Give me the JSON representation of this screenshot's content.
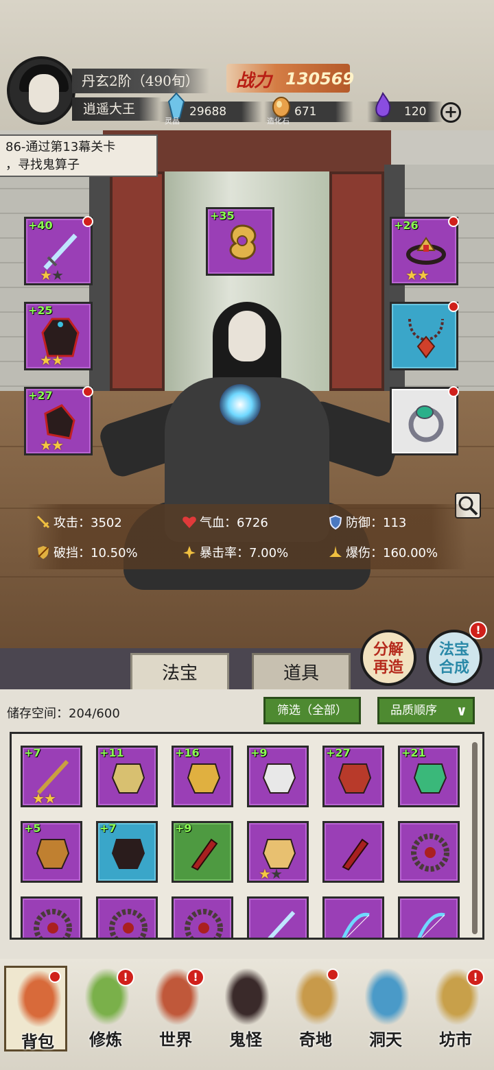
{
  "player": {
    "rank": "丹玄2阶（490旬）",
    "name": "逍遥大王",
    "power_label": "战力",
    "power_value": "130569"
  },
  "resources": [
    {
      "name": "灵晶",
      "value": "29688",
      "icon": "spirit-crystal-icon",
      "color": "#6fc3e8"
    },
    {
      "name": "造化石",
      "value": "671",
      "icon": "creation-stone-icon",
      "color": "#e8a14a"
    },
    {
      "name": "",
      "value": "120",
      "icon": "purple-flame-icon",
      "color": "#8a4de0"
    }
  ],
  "quest": {
    "text_line1": "86-通过第13幕关卡",
    "text_line2": "，寻找鬼算子"
  },
  "equipment": {
    "left": [
      {
        "level": "+40",
        "stars": 1,
        "max_stars": 2,
        "rarity": "purple",
        "item": "sword",
        "dot": true
      },
      {
        "level": "+25",
        "stars": 2,
        "max_stars": 2,
        "rarity": "purple",
        "item": "robe",
        "dot": false
      },
      {
        "level": "+27",
        "stars": 2,
        "max_stars": 2,
        "rarity": "purple",
        "item": "boots",
        "dot": true
      }
    ],
    "center": {
      "level": "+35",
      "rarity": "purple",
      "item": "golden-cloud-charm"
    },
    "right": [
      {
        "level": "+26",
        "stars": 2,
        "max_stars": 2,
        "rarity": "purple",
        "item": "crown",
        "dot": true
      },
      {
        "level": "",
        "stars": 0,
        "max_stars": 0,
        "rarity": "blue",
        "item": "necklace",
        "dot": true
      },
      {
        "level": "",
        "stars": 0,
        "max_stars": 0,
        "rarity": "white",
        "item": "ring",
        "dot": true
      }
    ]
  },
  "stats": [
    {
      "label": "攻击：",
      "value": "3502",
      "icon": "sword-icon"
    },
    {
      "label": "气血：",
      "value": "6726",
      "icon": "heart-icon"
    },
    {
      "label": "防御：",
      "value": "113",
      "icon": "shield-icon"
    },
    {
      "label": "破挡：",
      "value": "10.50%",
      "icon": "break-icon"
    },
    {
      "label": "暴击率：",
      "value": "7.00%",
      "icon": "crit-icon"
    },
    {
      "label": "爆伤：",
      "value": "160.00%",
      "icon": "crit-damage-icon"
    }
  ],
  "actions": {
    "decompose_line1": "分解",
    "decompose_line2": "再造",
    "synth_line1": "法宝",
    "synth_line2": "合成",
    "synth_badge": "!"
  },
  "tabs": {
    "treasure": "法宝",
    "items": "道具"
  },
  "inventory": {
    "storage_label": "储存空间：",
    "storage_value": "204/600",
    "filter_label": "筛选（全部）",
    "sort_label": "品质顺序",
    "items": [
      {
        "level": "+7",
        "rarity": "purple",
        "stars": 2,
        "max_stars": 2,
        "item": "staff"
      },
      {
        "level": "+11",
        "rarity": "purple",
        "stars": 0,
        "max_stars": 0,
        "item": "fan"
      },
      {
        "level": "+16",
        "rarity": "purple",
        "stars": 0,
        "max_stars": 0,
        "item": "gold-crown"
      },
      {
        "level": "+9",
        "rarity": "purple",
        "stars": 0,
        "max_stars": 0,
        "item": "white-armor"
      },
      {
        "level": "+27",
        "rarity": "purple",
        "stars": 0,
        "max_stars": 0,
        "item": "red-armor"
      },
      {
        "level": "+21",
        "rarity": "purple",
        "stars": 0,
        "max_stars": 0,
        "item": "jade-wreath"
      },
      {
        "level": "+5",
        "rarity": "purple",
        "stars": 0,
        "max_stars": 0,
        "item": "gem-crown"
      },
      {
        "level": "+7",
        "rarity": "blue",
        "stars": 0,
        "max_stars": 0,
        "item": "dark-robe"
      },
      {
        "level": "+9",
        "rarity": "green",
        "stars": 0,
        "max_stars": 0,
        "item": "red-dagger"
      },
      {
        "level": "",
        "rarity": "purple",
        "stars": 1,
        "max_stars": 2,
        "item": "gauntlet"
      },
      {
        "level": "",
        "rarity": "purple",
        "stars": 0,
        "max_stars": 0,
        "item": "red-dagger"
      },
      {
        "level": "",
        "rarity": "purple",
        "stars": 0,
        "max_stars": 0,
        "item": "thorn-wheel"
      },
      {
        "level": "",
        "rarity": "purple",
        "stars": 0,
        "max_stars": 0,
        "item": "thorn-wheel"
      },
      {
        "level": "",
        "rarity": "purple",
        "stars": 0,
        "max_stars": 0,
        "item": "thorn-wheel"
      },
      {
        "level": "",
        "rarity": "purple",
        "stars": 0,
        "max_stars": 0,
        "item": "thorn-wheel"
      },
      {
        "level": "",
        "rarity": "purple",
        "stars": 0,
        "max_stars": 0,
        "item": "sword"
      },
      {
        "level": "",
        "rarity": "purple",
        "stars": 0,
        "max_stars": 0,
        "item": "bow"
      },
      {
        "level": "",
        "rarity": "purple",
        "stars": 0,
        "max_stars": 0,
        "item": "bow"
      }
    ]
  },
  "nav": [
    {
      "label": "背包",
      "icon": "backpack-icon",
      "badge": "dot",
      "selected": true
    },
    {
      "label": "修炼",
      "icon": "cultivate-icon",
      "badge": "!",
      "selected": false
    },
    {
      "label": "世界",
      "icon": "world-scroll-icon",
      "badge": "!",
      "selected": false
    },
    {
      "label": "鬼怪",
      "icon": "ghost-egg-icon",
      "badge": "",
      "selected": false
    },
    {
      "label": "奇地",
      "icon": "wonderland-icon",
      "badge": "dot",
      "selected": false
    },
    {
      "label": "洞天",
      "icon": "grotto-portal-icon",
      "badge": "",
      "selected": false
    },
    {
      "label": "坊市",
      "icon": "market-cart-icon",
      "badge": "!",
      "selected": false
    }
  ]
}
